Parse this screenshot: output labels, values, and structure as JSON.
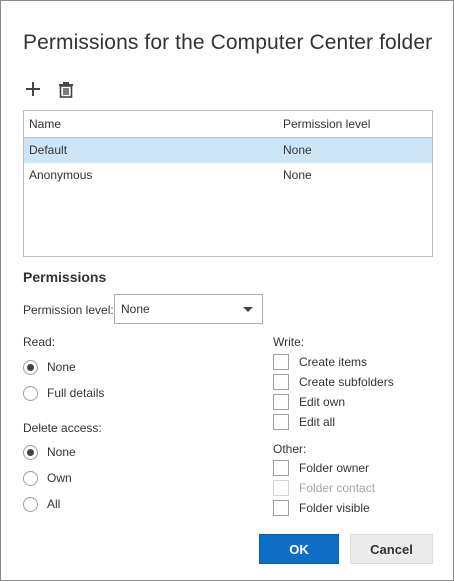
{
  "dialog": {
    "title": "Permissions for the Computer Center folder"
  },
  "toolbar": {
    "add_icon": "plus-icon",
    "delete_icon": "trash-icon"
  },
  "list": {
    "columns": [
      "Name",
      "Permission level"
    ],
    "rows": [
      {
        "name": "Default",
        "level": "None",
        "selected": true
      },
      {
        "name": "Anonymous",
        "level": "None",
        "selected": false
      }
    ]
  },
  "permissions": {
    "heading": "Permissions",
    "level_label": "Permission level:",
    "level_value": "None",
    "read": {
      "label": "Read:",
      "options": [
        "None",
        "Full details"
      ],
      "selected": "None"
    },
    "delete": {
      "label": "Delete access:",
      "options": [
        "None",
        "Own",
        "All"
      ],
      "selected": "None"
    },
    "write": {
      "label": "Write:",
      "options": [
        "Create items",
        "Create subfolders",
        "Edit own",
        "Edit all"
      ]
    },
    "other": {
      "label": "Other:",
      "options": [
        "Folder owner",
        "Folder contact",
        "Folder visible"
      ],
      "disabled": [
        "Folder contact"
      ]
    }
  },
  "buttons": {
    "ok": "OK",
    "cancel": "Cancel"
  },
  "colors": {
    "accent": "#0f6fc6",
    "selected_row": "#cde6f7"
  }
}
